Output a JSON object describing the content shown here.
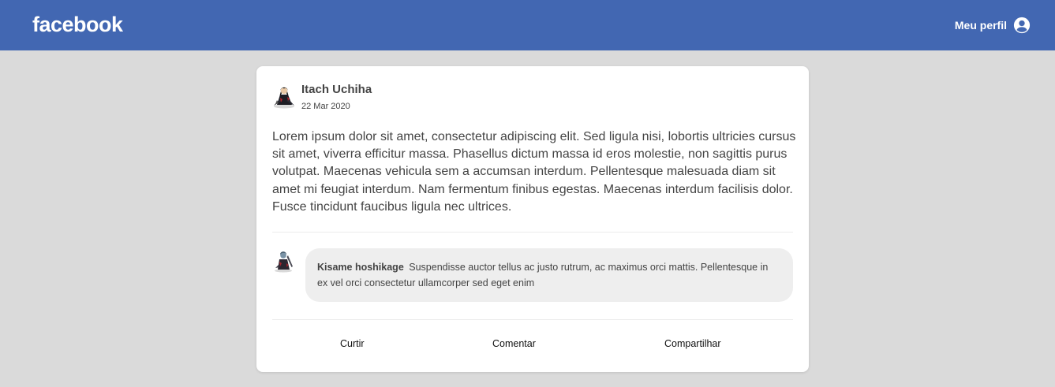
{
  "header": {
    "logo_text": "facebook",
    "profile_label": "Meu perfil",
    "profile_icon": "user-circle-icon",
    "brand_color": "#4267b2"
  },
  "post": {
    "author": "Itach Uchiha",
    "date": "22 Mar 2020",
    "avatar_icon": "itachi-avatar",
    "body": "Lorem ipsum dolor sit amet, consectetur adipiscing elit. Sed ligula nisi, lobortis ultricies cursus sit amet, viverra efficitur massa. Phasellus dictum massa id eros molestie, non sagittis purus volutpat. Maecenas vehicula sem a accumsan interdum. Pellentesque malesuada diam sit amet mi feugiat interdum. Nam fermentum finibus egestas. Maecenas interdum facilisis dolor. Fusce tincidunt faucibus ligula nec ultrices."
  },
  "comment": {
    "author": "Kisame hoshikage",
    "avatar_icon": "kisame-avatar",
    "text": "Suspendisse auctor tellus ac justo rutrum, ac maximus orci mattis. Pellentesque in ex vel orci consectetur ullamcorper sed eget enim"
  },
  "actions": {
    "like": "Curtir",
    "comment": "Comentar",
    "share": "Compartilhar"
  },
  "colors": {
    "background": "#dadada",
    "card": "#ffffff",
    "comment_bubble": "#eeeeee"
  }
}
